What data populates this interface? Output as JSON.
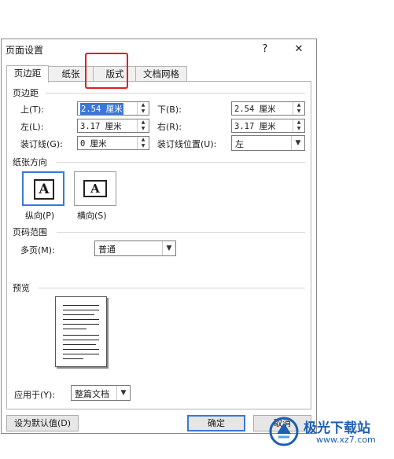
{
  "dialog": {
    "title": "页面设置",
    "help": "?",
    "close": "✕",
    "tabs": [
      "页边距",
      "纸张",
      "版式",
      "文档网格"
    ],
    "margins": {
      "section": "页边距",
      "top_label": "上(T):",
      "top_value": "2.54 厘米",
      "bottom_label": "下(B):",
      "bottom_value": "2.54 厘米",
      "left_label": "左(L):",
      "left_value": "3.17 厘米",
      "right_label": "右(R):",
      "right_value": "3.17 厘米",
      "gutter_label": "装订线(G):",
      "gutter_value": "0 厘米",
      "gutter_pos_label": "装订线位置(U):",
      "gutter_pos_value": "左"
    },
    "orientation": {
      "section": "纸张方向",
      "portrait": "纵向(P)",
      "landscape": "横向(S)",
      "glyph": "A"
    },
    "pages": {
      "section": "页码范围",
      "multiple_label": "多页(M):",
      "multiple_value": "普通"
    },
    "preview": {
      "section": "预览"
    },
    "apply": {
      "label": "应用于(Y):",
      "value": "整篇文档"
    },
    "buttons": {
      "set_default": "设为默认值(D)",
      "ok": "确定",
      "cancel": "取消"
    }
  },
  "watermark": {
    "name": "极光下载站",
    "url": "www.xz7.com"
  },
  "colors": {
    "accent": "#3a78d8",
    "highlight": "#e02020",
    "watermark": "#1d5fb0"
  }
}
